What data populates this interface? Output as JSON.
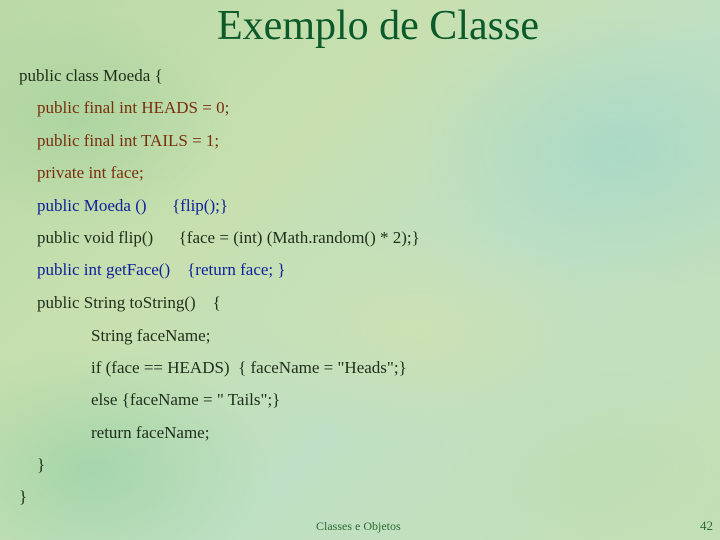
{
  "slide": {
    "title": "Exemplo de Classe",
    "code_lines": [
      {
        "text": "public class Moeda {",
        "color": "#1e2e1a"
      },
      {
        "text": "public final int HEADS = 0;",
        "color": "#7a2e0e"
      },
      {
        "text": "public final int TAILS = 1;",
        "color": "#7a2e0e"
      },
      {
        "text": "private int face;",
        "color": "#7a2e0e"
      },
      {
        "text": "public Moeda ()      {flip();}",
        "color": "#10209a"
      },
      {
        "text": "public void flip()      {face = (int) (Math.random() * 2);}",
        "color": "#1e2e1a"
      },
      {
        "text": "public int getFace()    {return face; }",
        "color": "#10209a"
      },
      {
        "text": "public String toString()    {",
        "color": "#1e2e1a"
      },
      {
        "text": "String faceName;",
        "color": "#1e2e1a"
      },
      {
        "text": "if (face == HEADS)  { faceName = \"Heads\";}",
        "color": "#1e2e1a"
      },
      {
        "text": "else {faceName = \" Tails\";}",
        "color": "#1e2e1a"
      },
      {
        "text": "return faceName;",
        "color": "#1e2e1a"
      },
      {
        "text": "}",
        "color": "#1e2e1a"
      },
      {
        "text": "}",
        "color": "#1e2e1a"
      }
    ],
    "footer": "Classes e Objetos",
    "page_number": "42"
  }
}
